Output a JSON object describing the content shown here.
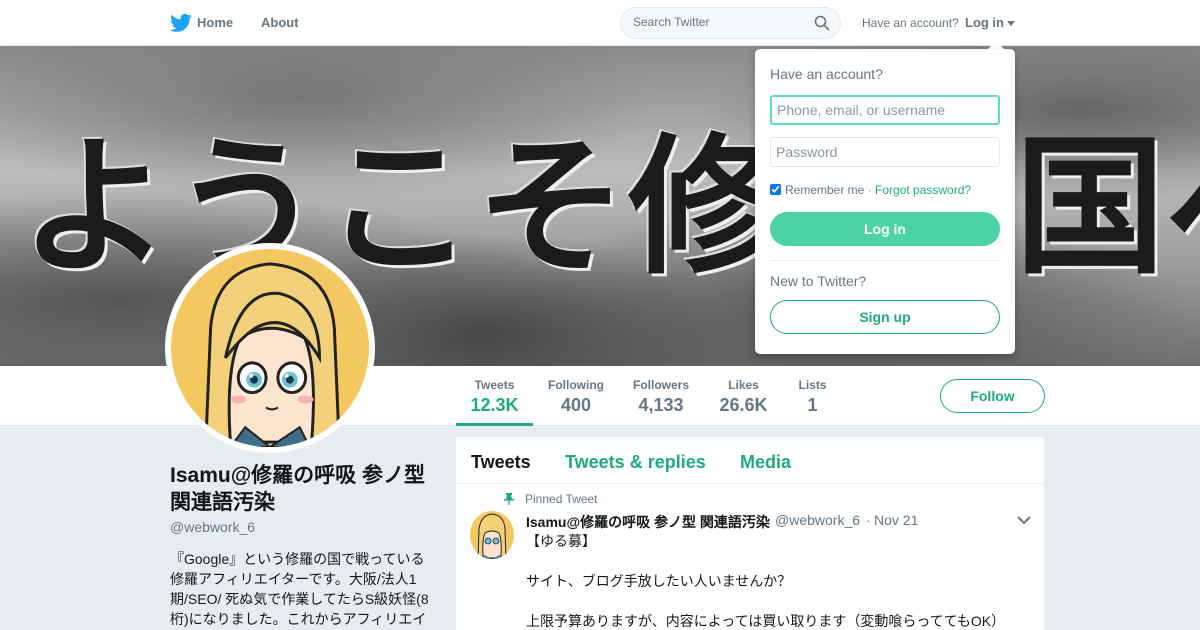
{
  "nav": {
    "home_label": "Home",
    "about_label": "About",
    "search_placeholder": "Search Twitter",
    "have_account_text": "Have an account?",
    "login_label": "Log in",
    "brand_color": "#1da1f2",
    "logo_icon": "twitter-bird-icon"
  },
  "banner": {
    "text_left": "ようこそ修羅",
    "text_right": "国へ"
  },
  "profile_nav": {
    "stats": [
      {
        "label": "Tweets",
        "value": "12.3K"
      },
      {
        "label": "Following",
        "value": "400"
      },
      {
        "label": "Followers",
        "value": "4,133"
      },
      {
        "label": "Likes",
        "value": "26.6K"
      },
      {
        "label": "Lists",
        "value": "1"
      }
    ],
    "follow_label": "Follow",
    "accent_color": "#1dab7f"
  },
  "profile": {
    "name": "Isamu@修羅の呼吸 参ノ型 関連語汚染",
    "handle": "@webwork_6",
    "bio": "『Google』という修羅の国で戦っている修羅アフィリエイターです。大阪/法人1期/SEO/ 死ぬ気で作業してたらS級妖怪(8桁)になりました。これからアフィリエイ"
  },
  "timeline": {
    "tabs": [
      "Tweets",
      "Tweets & replies",
      "Media"
    ],
    "pinned_label": "Pinned Tweet",
    "tweet": {
      "name": "Isamu@修羅の呼吸 参ノ型 関連語汚染",
      "handle": "@webwork_6",
      "date": "Nov 21",
      "lines": [
        "【ゆる募】",
        "サイト、ブログ手放したい人いませんか？",
        "上限予算ありますが、内容によっては買い取ります（変動喰らっててもOK）"
      ]
    }
  },
  "login_dropdown": {
    "title": "Have an account?",
    "username_placeholder": "Phone, email, or username",
    "password_placeholder": "Password",
    "remember_label": "Remember me",
    "separator": " · ",
    "forgot_label": "Forgot password?",
    "login_button": "Log in",
    "new_text": "New to Twitter?",
    "signup_button": "Sign up"
  }
}
